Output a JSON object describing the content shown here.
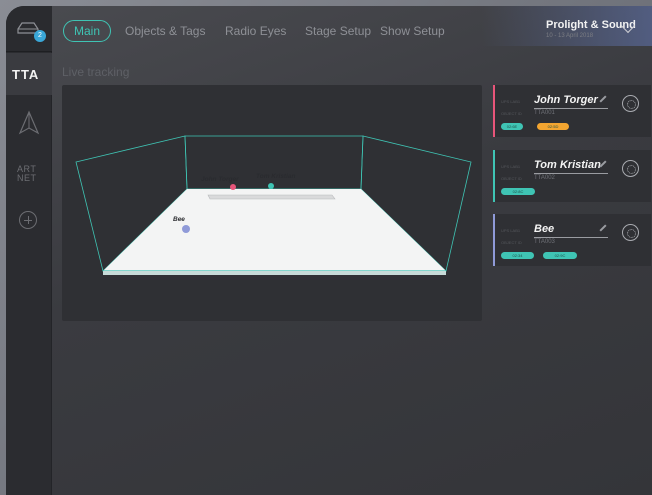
{
  "nav": {
    "tabs": [
      {
        "label": "Main",
        "active": true
      },
      {
        "label": "Objects & Tags",
        "active": false
      },
      {
        "label": "Radio Eyes",
        "active": false
      },
      {
        "label": "Stage Setup",
        "active": false
      },
      {
        "label": "Show Setup",
        "active": false
      }
    ]
  },
  "sidebar": {
    "badge_count": "2",
    "logo": "TTA",
    "artnet_line1": "ART",
    "artnet_line2": "NET"
  },
  "brand": {
    "name": "Prolight & Sound",
    "date": "10 - 13 April 2018"
  },
  "page": {
    "label": "Live tracking"
  },
  "stage": {
    "markers": [
      {
        "name": "John Torger",
        "sub": "TTA001",
        "color": "#e8557a"
      },
      {
        "name": "Tom Kristian",
        "sub": "TTA002",
        "color": "#3fc4b4"
      },
      {
        "name": "Bee",
        "sub": "TTA003",
        "color": "#8f9ad8"
      }
    ]
  },
  "cards": [
    {
      "name": "John Torger",
      "label1": "UPS LAB1",
      "label2": "OBJECT ID",
      "id": "TTA001",
      "accent": "#e8557a",
      "pills": [
        {
          "text": "02:6E",
          "color": "#3fc4b4"
        },
        {
          "text": "02:5D",
          "color": "#f3a530"
        }
      ]
    },
    {
      "name": "Tom Kristian",
      "label1": "UPS LAB1",
      "label2": "OBJECT ID",
      "id": "TTA002",
      "accent": "#3fc4b4",
      "pills": [
        {
          "text": "02:8C",
          "color": "#3fc4b4"
        }
      ]
    },
    {
      "name": "Bee",
      "label1": "UPS LAB1",
      "label2": "OBJECT ID",
      "id": "TTA003",
      "accent": "#8f9ad8",
      "pills": [
        {
          "text": "02:34",
          "color": "#3fc4b4"
        },
        {
          "text": "02:9C",
          "color": "#3fc4b4"
        }
      ]
    }
  ]
}
